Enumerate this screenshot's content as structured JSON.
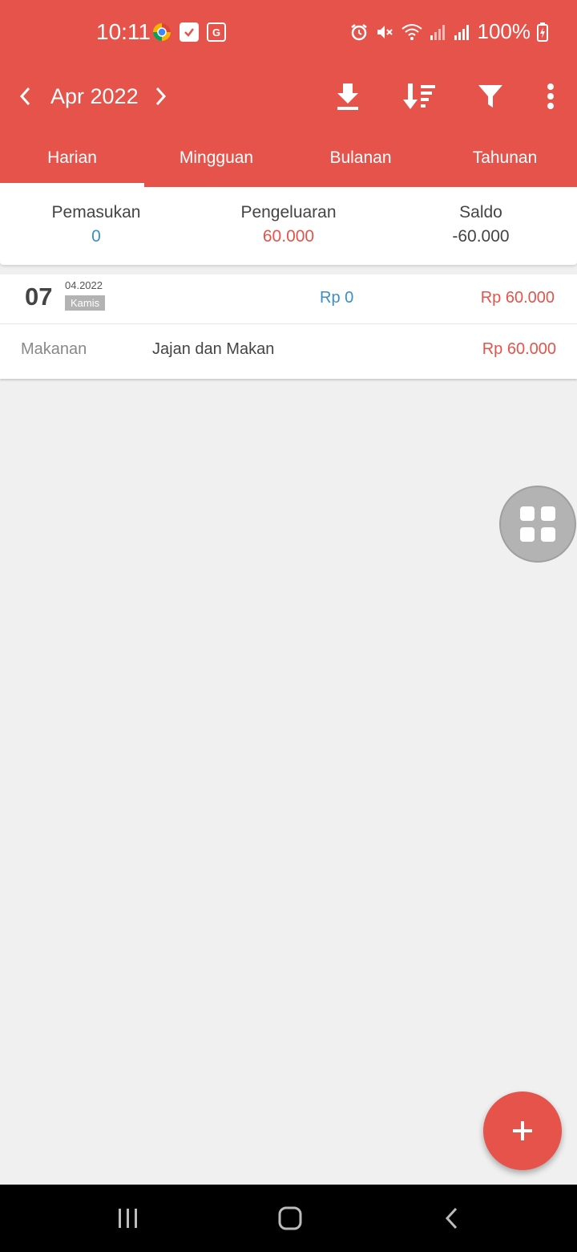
{
  "status_bar": {
    "time": "10:11",
    "battery": "100%",
    "icons": [
      "chrome-icon",
      "check-icon",
      "translate-icon",
      "alarm-icon",
      "mute-icon",
      "wifi-icon",
      "signal-icon",
      "signal-icon",
      "battery-charging-icon"
    ]
  },
  "header": {
    "month": "Apr 2022",
    "actions": [
      "download-icon",
      "sort-icon",
      "filter-icon",
      "more-icon"
    ]
  },
  "tabs": [
    {
      "label": "Harian",
      "active": true
    },
    {
      "label": "Mingguan",
      "active": false
    },
    {
      "label": "Bulanan",
      "active": false
    },
    {
      "label": "Tahunan",
      "active": false
    }
  ],
  "summary": {
    "income_label": "Pemasukan",
    "income_value": "0",
    "expense_label": "Pengeluaran",
    "expense_value": "60.000",
    "balance_label": "Saldo",
    "balance_value": "-60.000"
  },
  "day": {
    "day_number": "07",
    "month_year": "04.2022",
    "weekday": "Kamis",
    "income": "Rp 0",
    "expense": "Rp 60.000",
    "transactions": [
      {
        "category": "Makanan",
        "note": "Jajan dan Makan",
        "amount": "Rp 60.000"
      }
    ]
  },
  "colors": {
    "primary": "#e5534b",
    "income": "#3a8fc8",
    "expense": "#e5534b"
  }
}
